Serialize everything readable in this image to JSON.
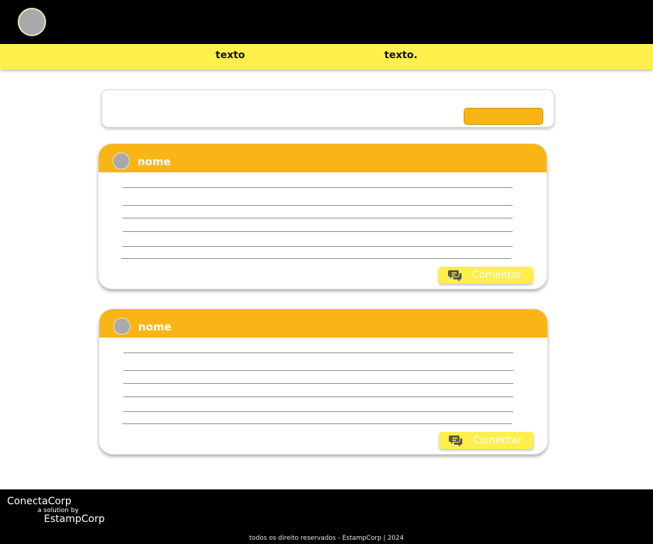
{
  "nav": {
    "links": [
      "texto",
      "texto."
    ]
  },
  "posts": [
    {
      "name": "nome",
      "comment_label": "Comentar"
    },
    {
      "name": "nome",
      "comment_label": "Comentar"
    }
  ],
  "footer": {
    "brand": "ConectaCorp",
    "tagline": "a solution by",
    "company": "EstampCorp",
    "copyright": "todos os direito reservados - EstampCorp | 2024"
  },
  "icons": {
    "comment": "chat-bubbles-icon"
  },
  "colors": {
    "accent_yellow": "#ffef4a",
    "accent_orange": "#f9b515",
    "dark": "#000000",
    "avatar_gray": "#a9a9a9"
  }
}
